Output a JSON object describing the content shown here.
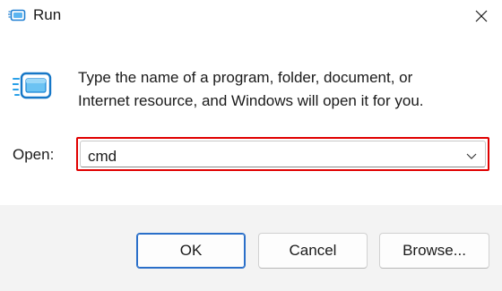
{
  "window": {
    "title": "Run",
    "close_icon": "close-icon",
    "app_icon": "run-dialog-icon"
  },
  "body": {
    "icon": "run-dialog-icon",
    "description_line1": "Type the name of a program, folder, document, or",
    "description_line2": "Internet resource, and Windows will open it for you.",
    "open_label": "Open:",
    "open_value": "cmd",
    "dropdown_icon": "chevron-down-icon"
  },
  "buttons": {
    "ok": "OK",
    "cancel": "Cancel",
    "browse": "Browse..."
  },
  "colors": {
    "highlight_border": "#e00000",
    "default_button_border": "#2a6fc9",
    "footer_bg": "#f3f3f3"
  }
}
